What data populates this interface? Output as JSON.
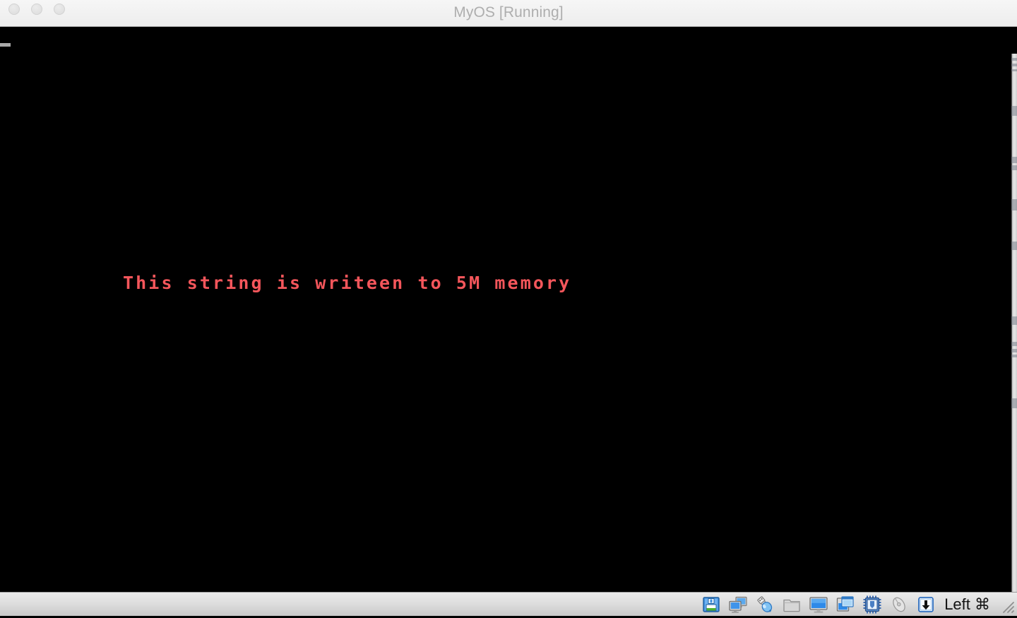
{
  "window": {
    "title": "MyOS [Running]",
    "traffic_lights": [
      {
        "name": "close",
        "color": "#e2e2e2"
      },
      {
        "name": "minimize",
        "color": "#e2e2e2"
      },
      {
        "name": "zoom",
        "color": "#e2e2e2"
      }
    ]
  },
  "screen": {
    "background_color": "#000000",
    "text_color": "#f4565b",
    "cursor_color": "#a9a9a9",
    "lines": [
      "This string is writeen to 5M memory"
    ]
  },
  "statusbar": {
    "host_key_label": "Left ⌘",
    "icons": [
      {
        "name": "floppy-disk-icon",
        "title": "Floppy Disk",
        "state": "active"
      },
      {
        "name": "network-adapter-icon",
        "title": "Network Adapters",
        "state": "active"
      },
      {
        "name": "usb-device-icon",
        "title": "USB Devices",
        "state": "active"
      },
      {
        "name": "shared-folder-icon",
        "title": "Shared Folders",
        "state": "inactive"
      },
      {
        "name": "display-icon",
        "title": "Display",
        "state": "active"
      },
      {
        "name": "seamless-mode-icon",
        "title": "Seamless Mode",
        "state": "active"
      },
      {
        "name": "virtualization-cpu-icon",
        "title": "Virtualization",
        "state": "active"
      },
      {
        "name": "mouse-pointer-icon",
        "title": "Mouse Integration",
        "state": "inactive"
      },
      {
        "name": "host-key-icon",
        "title": "Host Key",
        "state": "active"
      }
    ]
  }
}
